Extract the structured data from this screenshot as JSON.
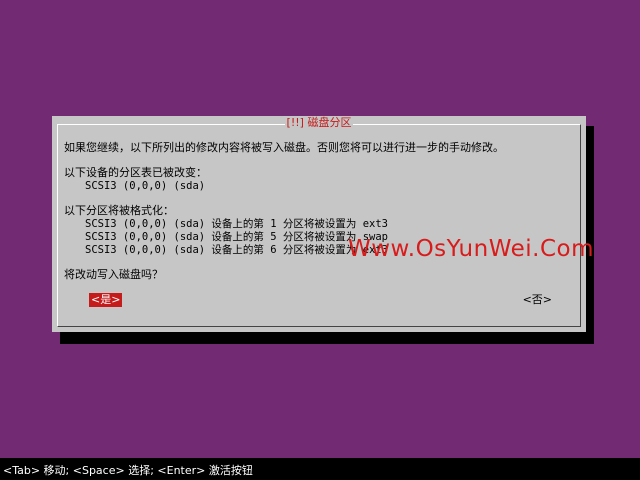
{
  "dialog": {
    "title": "[!!] 磁盘分区",
    "intro": "如果您继续，以下所列出的修改内容将被写入磁盘。否则您将可以进行进一步的手动修改。",
    "tables_heading": "以下设备的分区表已被改变：",
    "tables_device": "SCSI3 (0,0,0) (sda)",
    "format_heading": "以下分区将被格式化：",
    "format_items": [
      "SCSI3 (0,0,0) (sda) 设备上的第 1 分区将被设置为 ext3",
      "SCSI3 (0,0,0) (sda) 设备上的第 5 分区将被设置为 swap",
      "SCSI3 (0,0,0) (sda) 设备上的第 6 分区将被设置为 ext3"
    ],
    "question": "将改动写入磁盘吗？",
    "yes_label": "<是>",
    "no_label": "<否>"
  },
  "watermark": "Www.OsYunWei.Com",
  "statusbar": "<Tab> 移动; <Space> 选择; <Enter> 激活按钮",
  "colors": {
    "background": "#722a72",
    "dialog": "#c6c6c6",
    "accent": "#c61b1b",
    "statusbar": "#000000"
  }
}
